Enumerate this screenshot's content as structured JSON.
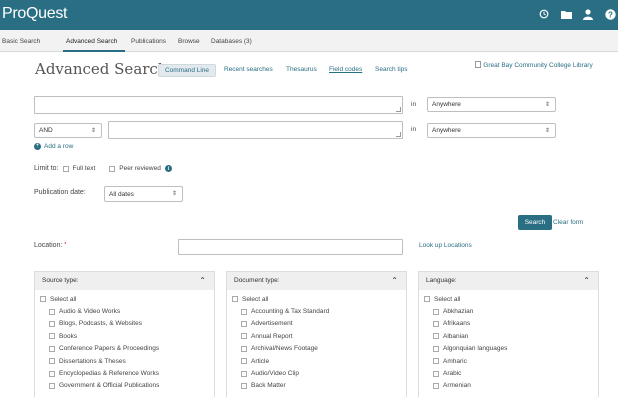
{
  "brand": "ProQuest",
  "nav": {
    "basic": "Basic Search",
    "advanced": "Advanced Search",
    "publications": "Publications",
    "browse": "Browse",
    "databases": "Databases (3)"
  },
  "title": "Advanced Search",
  "toplinks": {
    "command_line": "Command Line",
    "recent": "Recent searches",
    "thesaurus": "Thesaurus",
    "field_codes": "Field codes",
    "tips": "Search tips"
  },
  "library": "Great Bay Community College Library",
  "search_rows": [
    {
      "value": "",
      "in_label": "in",
      "field": "Anywhere"
    },
    {
      "operator": "AND",
      "value": "",
      "in_label": "in",
      "field": "Anywhere"
    }
  ],
  "add_row": "Add a row",
  "limit": {
    "label": "Limit to:",
    "full_text": "Full text",
    "peer_reviewed": "Peer reviewed"
  },
  "pub_date": {
    "label": "Publication date:",
    "value": "All dates"
  },
  "buttons": {
    "search": "Search",
    "clear": "Clear form"
  },
  "location": {
    "label": "Location:",
    "required_mark": "*",
    "value": "",
    "lookup": "Look up Locations"
  },
  "panels": {
    "source": {
      "title": "Source type:",
      "select_all": "Select all",
      "items": [
        "Audio & Video Works",
        "Blogs, Podcasts, & Websites",
        "Books",
        "Conference Papers & Proceedings",
        "Dissertations & Theses",
        "Encyclopedias & Reference Works",
        "Government & Official Publications"
      ]
    },
    "document": {
      "title": "Document type:",
      "select_all": "Select all",
      "items": [
        "Accounting & Tax Standard",
        "Advertisement",
        "Annual Report",
        "Archival/News Footage",
        "Article",
        "Audio/Video Clip",
        "Back Matter"
      ]
    },
    "language": {
      "title": "Language:",
      "select_all": "Select all",
      "items": [
        "Abkhazian",
        "Afrikaans",
        "Albanian",
        "Algonquian languages",
        "Amharic",
        "Arabic",
        "Armenian"
      ]
    }
  },
  "colors": {
    "brand": "#2a6e84",
    "link": "#2a6e84"
  }
}
